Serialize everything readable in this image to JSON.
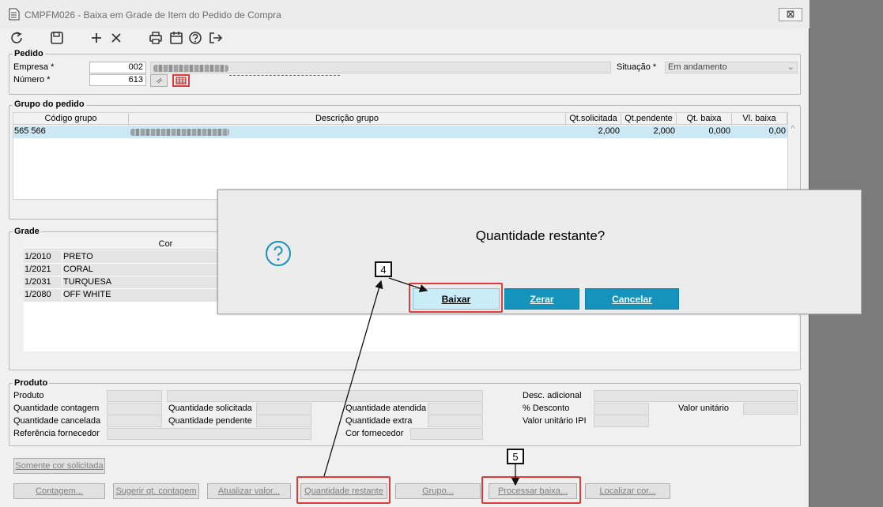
{
  "window": {
    "title": "CMPFM026 - Baixa em Grade de Item do Pedido de Compra",
    "close_glyph": "⊠"
  },
  "toolbar": {
    "icons": [
      "refresh-icon",
      "save-icon",
      "add-icon",
      "delete-icon",
      "print-icon",
      "calendar-icon",
      "help-icon",
      "exit-icon"
    ]
  },
  "pedido": {
    "legend": "Pedido",
    "empresa_label": "Empresa *",
    "empresa_value": "002",
    "numero_label": "Número *",
    "numero_value": "613",
    "situacao_label": "Situação *",
    "situacao_value": "Em andamento"
  },
  "grupo": {
    "legend": "Grupo do pedido",
    "columns": [
      "Código grupo",
      "Descrição grupo",
      "Qt.solicitada",
      "Qt.pendente",
      "Qt. baixa",
      "Vl. baixa"
    ],
    "rows": [
      {
        "codigo": "565 566",
        "qt_solicitada": "2,000",
        "qt_pendente": "2,000",
        "qt_baixa": "0,000",
        "vl_baixa": "0,00"
      }
    ]
  },
  "grade": {
    "legend": "Grade",
    "column_cor": "Cor",
    "rows": [
      {
        "code": "1/2010",
        "name": "PRETO"
      },
      {
        "code": "1/2021",
        "name": "CORAL"
      },
      {
        "code": "1/2031",
        "name": "TURQUESA"
      },
      {
        "code": "1/2080",
        "name": "OFF WHITE"
      }
    ]
  },
  "produto": {
    "legend": "Produto",
    "labels": {
      "produto": "Produto",
      "qt_contagem": "Quantidade contagem",
      "qt_cancelada": "Quantidade cancelada",
      "ref_fornecedor": "Referência fornecedor",
      "qt_solicitada": "Quantidade solicitada",
      "qt_pendente": "Quantidade pendente",
      "qt_atendida": "Quantidade atendida",
      "qt_extra": "Quantidade extra",
      "cor_fornecedor": "Cor fornecedor",
      "desc_adicional": "Desc. adicional",
      "pct_desconto": "% Desconto",
      "valor_unitario": "Valor unitário",
      "valor_unitario_ipi": "Valor unitário IPI"
    }
  },
  "buttons": {
    "somente_cor": "Somente cor solicitada",
    "contagem": "Contagem...",
    "sugerir": "Sugerir qt. contagem",
    "atualizar": "Atualizar valor...",
    "qt_restante": "Quantidade restante",
    "grupo": "Grupo...",
    "processar": "Processar baixa...",
    "localizar": "Localizar cor..."
  },
  "dialog": {
    "message": "Quantidade restante?",
    "icon": "question-icon",
    "baixar": "Baixar",
    "zerar": "Zerar",
    "cancelar": "Cancelar"
  },
  "callouts": {
    "step4": "4",
    "step5": "5"
  },
  "colors": {
    "dialog_button": "#1593bd",
    "highlight": "#e03a3a",
    "selected_row": "#cce8f4"
  }
}
